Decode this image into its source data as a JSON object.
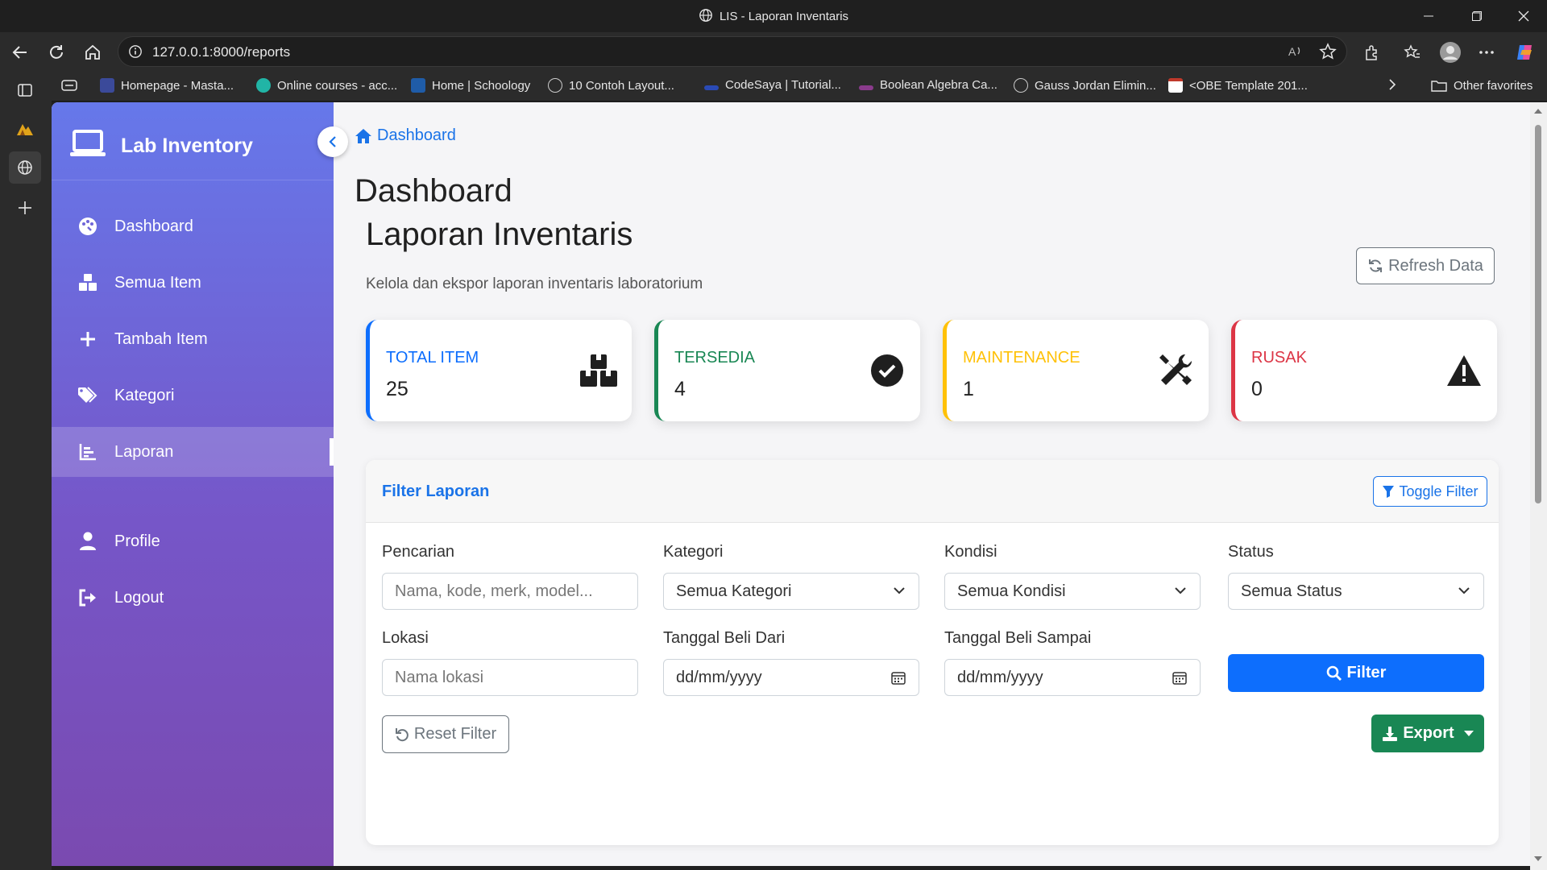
{
  "browser": {
    "window_title": "LIS - Laporan Inventaris",
    "url": "127.0.0.1:8000/reports",
    "bookmarks": [
      {
        "label": "Homepage - Masta...",
        "color": "#3b4a9a"
      },
      {
        "label": "Online courses - acc...",
        "color": "#21b5a6"
      },
      {
        "label": "Home | Schoology",
        "color": "#1f5ca8"
      },
      {
        "label": "10 Contoh Layout...",
        "color": "#888888"
      },
      {
        "label": "CodeSaya | Tutorial...",
        "color": "#2a4ab5"
      },
      {
        "label": "Boolean Algebra Ca...",
        "color": "#8a3b8c"
      },
      {
        "label": "Gauss Jordan Elimin...",
        "color": "#888888"
      },
      {
        "label": "<OBE Template 201...",
        "color": "#c0392b"
      }
    ],
    "other_favorites": "Other favorites"
  },
  "sidebar": {
    "brand": "Lab Inventory",
    "items": [
      {
        "label": "Dashboard",
        "icon": "palette-icon"
      },
      {
        "label": "Semua Item",
        "icon": "boxes-icon"
      },
      {
        "label": "Tambah Item",
        "icon": "plus-icon"
      },
      {
        "label": "Kategori",
        "icon": "tags-icon"
      },
      {
        "label": "Laporan",
        "icon": "chart-bar-icon",
        "active": true
      },
      {
        "label": "Profile",
        "icon": "user-icon"
      },
      {
        "label": "Logout",
        "icon": "logout-icon"
      }
    ]
  },
  "main": {
    "breadcrumb": "Dashboard",
    "page_title": "Dashboard",
    "report_title": "Laporan Inventaris",
    "report_subtitle": "Kelola dan ekspor laporan inventaris laboratorium",
    "refresh_label": "Refresh Data"
  },
  "stats": [
    {
      "label": "TOTAL ITEM",
      "value": "25",
      "color": "#0d6efd"
    },
    {
      "label": "TERSEDIA",
      "value": "4",
      "color": "#198754"
    },
    {
      "label": "MAINTENANCE",
      "value": "1",
      "color": "#ffc107"
    },
    {
      "label": "RUSAK",
      "value": "0",
      "color": "#dc3545"
    }
  ],
  "filter": {
    "title": "Filter Laporan",
    "toggle_label": "Toggle Filter",
    "search_label": "Pencarian",
    "search_placeholder": "Nama, kode, merk, model...",
    "category_label": "Kategori",
    "category_value": "Semua Kategori",
    "condition_label": "Kondisi",
    "condition_value": "Semua Kondisi",
    "status_label": "Status",
    "status_value": "Semua Status",
    "location_label": "Lokasi",
    "location_placeholder": "Nama lokasi",
    "date_from_label": "Tanggal Beli Dari",
    "date_from_value": "dd/mm/yyyy",
    "date_to_label": "Tanggal Beli Sampai",
    "date_to_value": "dd/mm/yyyy",
    "filter_button": "Filter",
    "reset_button": "Reset Filter",
    "export_button": "Export"
  }
}
